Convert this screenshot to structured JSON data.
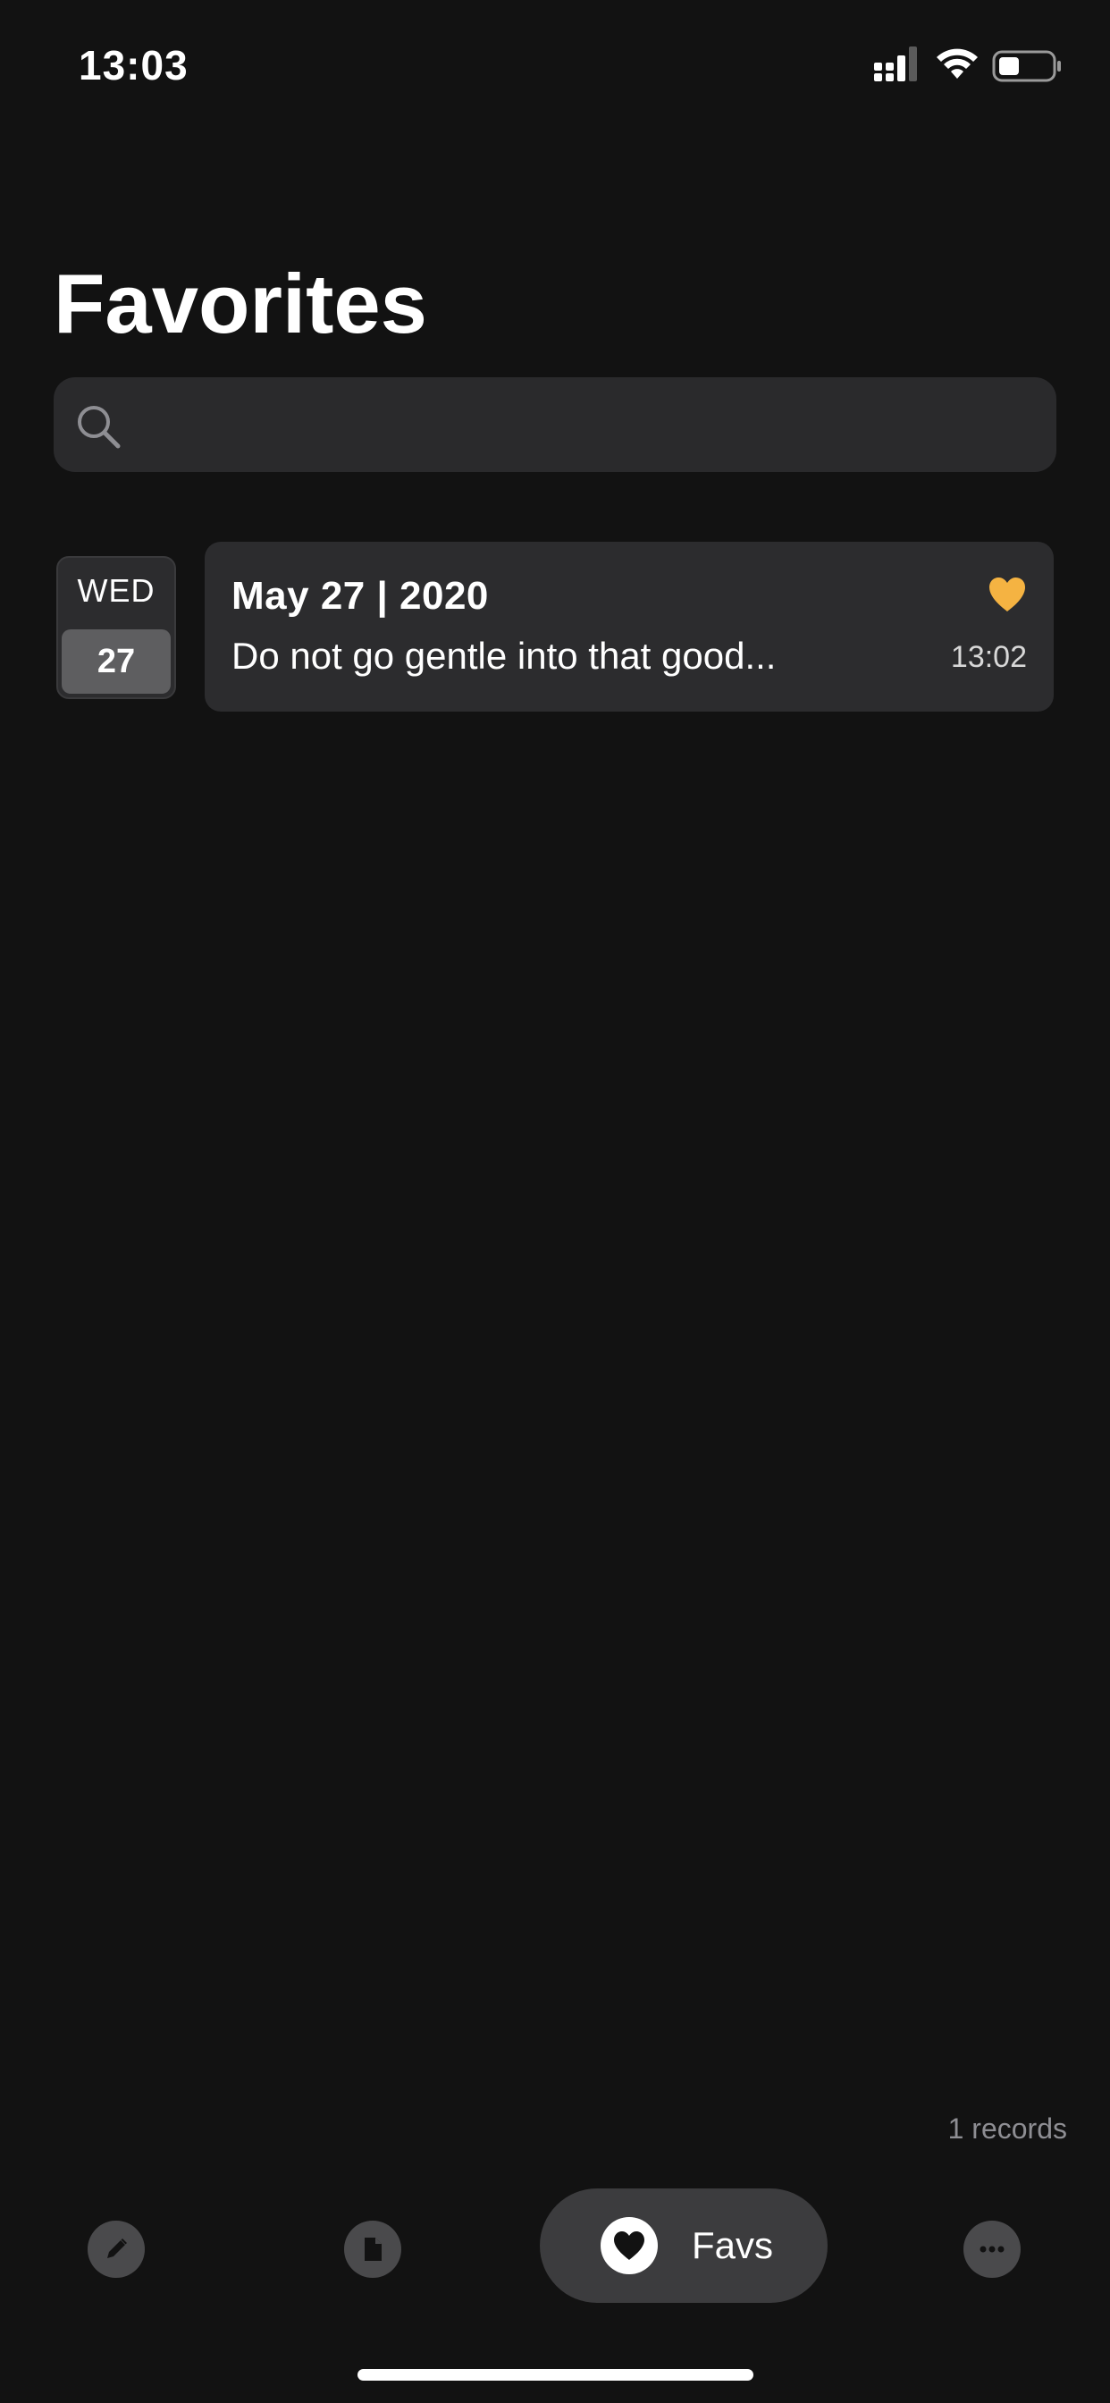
{
  "status_bar": {
    "time": "13:03",
    "icons": [
      "cellular-signal-icon",
      "wifi-icon",
      "battery-icon"
    ]
  },
  "header": {
    "title": "Favorites"
  },
  "search": {
    "value": "",
    "placeholder": "",
    "icon": "search-icon"
  },
  "entries": [
    {
      "weekday": "WED",
      "day": "27",
      "date_label": "May 27 | 2020",
      "preview": "Do not go gentle into that good...",
      "time": "13:02",
      "favorited": true,
      "heart_color": "#F5B342"
    }
  ],
  "footer": {
    "records": "1 records"
  },
  "tab_bar": {
    "items": [
      {
        "icon": "pencil-icon",
        "label": ""
      },
      {
        "icon": "document-icon",
        "label": ""
      },
      {
        "icon": "heart-icon",
        "label": "Favs",
        "active": true
      },
      {
        "icon": "more-icon",
        "label": ""
      }
    ]
  },
  "colors": {
    "background": "#121212",
    "card": "#2C2C2E",
    "accent_heart": "#F5B342"
  }
}
